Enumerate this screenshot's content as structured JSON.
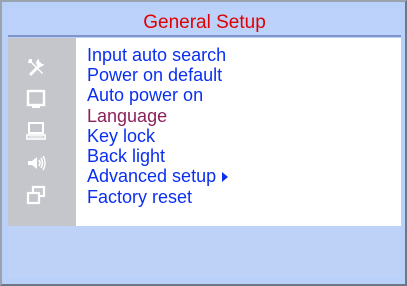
{
  "title": "General Setup",
  "side_icons": [
    {
      "name": "tools-icon"
    },
    {
      "name": "display-icon"
    },
    {
      "name": "computer-icon"
    },
    {
      "name": "speaker-icon"
    },
    {
      "name": "windows-icon"
    }
  ],
  "menu": {
    "items": [
      {
        "label": "Input auto search",
        "selected": false
      },
      {
        "label": "Power on default",
        "selected": false
      },
      {
        "label": "Auto power on",
        "selected": false
      },
      {
        "label": "Language",
        "selected": true
      },
      {
        "label": "Key lock",
        "selected": false
      },
      {
        "label": "Back light",
        "selected": false
      },
      {
        "label": "Advanced setup",
        "selected": false,
        "has_submenu": true
      },
      {
        "label": "Factory reset",
        "selected": false
      }
    ]
  },
  "colors": {
    "title": "#e00000",
    "menu_text": "#0b2ff0",
    "selected_text": "#8b2159",
    "frame": "#b9d0f8",
    "side_panel": "#c4c6cb"
  }
}
